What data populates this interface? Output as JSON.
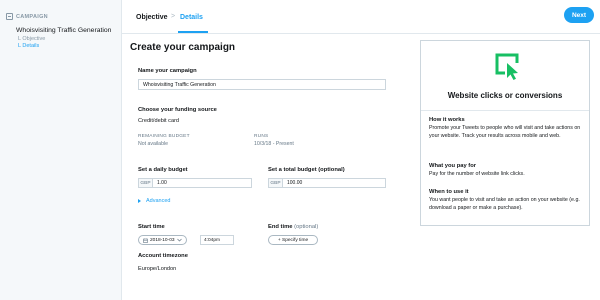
{
  "sidebar": {
    "header": "CAMPAIGN",
    "campaign_name": "Whoisvisiting Traffic Generation",
    "steps": [
      {
        "label": "L Objective",
        "active": false
      },
      {
        "label": "L Details",
        "active": true
      }
    ]
  },
  "topbar": {
    "crumb_objective": "Objective",
    "crumb_separator": ">",
    "crumb_details": "Details",
    "next_label": "Next"
  },
  "form": {
    "title": "Create your campaign",
    "name_label": "Name your campaign",
    "name_value": "Whoisvisiting Traffic Generation",
    "funding_label": "Choose your funding source",
    "funding_value": "Credit/debit card",
    "remaining_label": "REMAINING BUDGET",
    "remaining_value": "Not available",
    "runs_label": "RUNS",
    "runs_value": "10/3/18 - Present",
    "daily_label": "Set a daily budget",
    "daily_currency": "GBP",
    "daily_value": "1.00",
    "total_label": "Set a total budget (optional)",
    "total_currency": "GBP",
    "total_value": "100.00",
    "advanced_label": "Advanced",
    "start_label": "Start time",
    "start_date": "2018-10-03",
    "start_time": "4:04pm",
    "end_label": "End time",
    "end_optional": "(optional)",
    "specify_time": "+ Specify time",
    "timezone_label": "Account timezone",
    "timezone_value": "Europe/London"
  },
  "card": {
    "title": "Website clicks or conversions",
    "how_title": "How it works",
    "how_text": "Promote your Tweets to people who will visit and take actions on your website. Track your results across mobile and web.",
    "pay_title": "What you pay for",
    "pay_text": "Pay for the number of website link clicks.",
    "when_title": "When to use it",
    "when_text": "You want people to visit and take an action on your website (e.g. download a paper or make a purchase).",
    "accent": "#17bf63"
  },
  "colors": {
    "brand": "#1da1f2",
    "border": "#ccd6dd"
  }
}
